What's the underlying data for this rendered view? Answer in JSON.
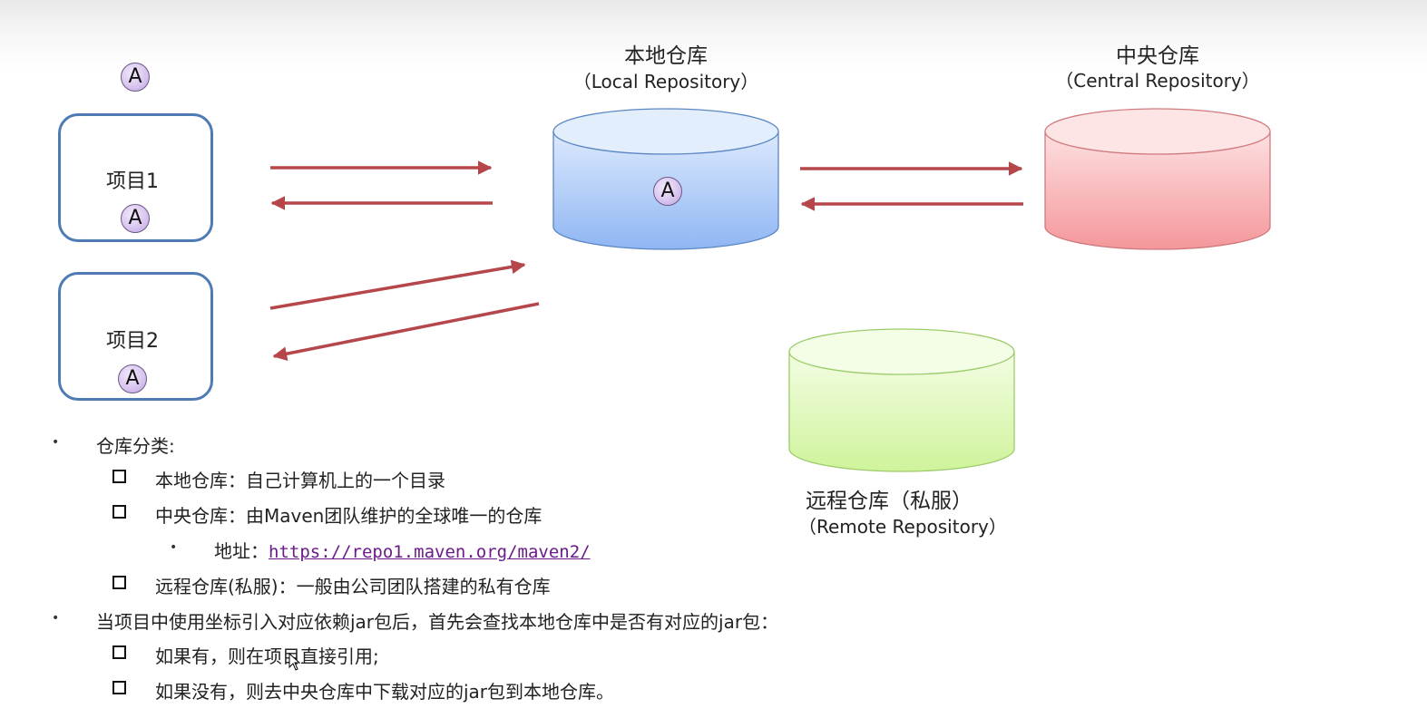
{
  "repos": {
    "local": {
      "title": "本地仓库",
      "subtitle": "（Local Repository）",
      "color": "#9ec2f7"
    },
    "central": {
      "title": "中央仓库",
      "subtitle": "（Central Repository）",
      "color": "#f8a4a7"
    },
    "remote": {
      "title": "远程仓库（私服）",
      "subtitle": "（Remote Repository）",
      "color": "#d8f7a8"
    }
  },
  "projects": [
    {
      "label": "项目1",
      "badge": "A"
    },
    {
      "label": "项目2",
      "badge": "A"
    }
  ],
  "badges": {
    "top": "A",
    "local": "A"
  },
  "arrow_color": "#b5474b",
  "notes": {
    "b1": "仓库分类:",
    "b1_items": [
      "本地仓库：自己计算机上的一个目录",
      "中央仓库：由Maven团队维护的全球唯一的仓库"
    ],
    "addr_label": "地址：",
    "addr_url": "https://repo1.maven.org/maven2/",
    "b1_item3": "远程仓库(私服)：一般由公司团队搭建的私有仓库",
    "b2": "当项目中使用坐标引入对应依赖jar包后，首先会查找本地仓库中是否有对应的jar包：",
    "b2_items": [
      "如果有，则在项目直接引用;",
      "如果没有，则去中央仓库中下载对应的jar包到本地仓库。"
    ]
  }
}
